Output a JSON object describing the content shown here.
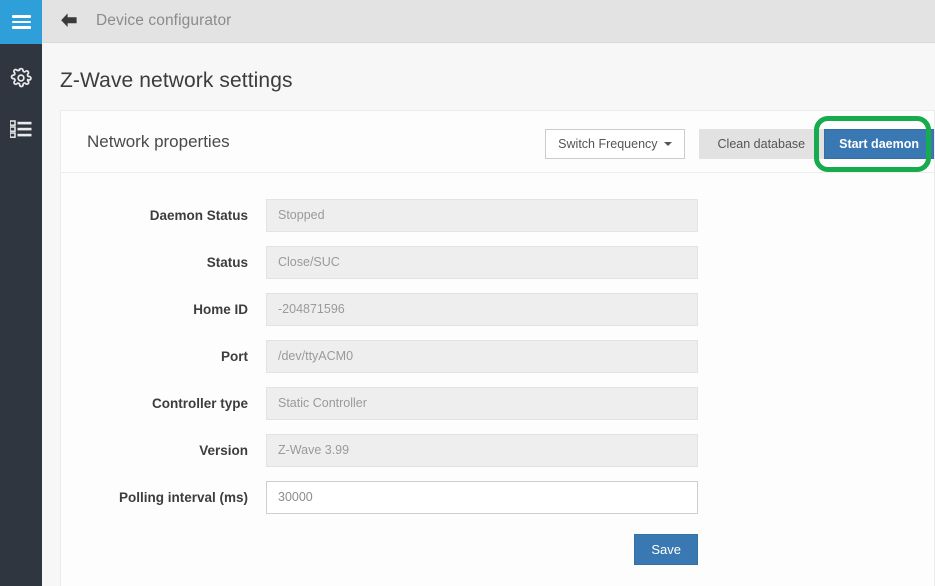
{
  "sidebar": {
    "items": [
      {
        "name": "menu-toggle",
        "icon": "hamburger-icon",
        "active": true
      },
      {
        "name": "settings",
        "icon": "gear-icon",
        "active": false
      },
      {
        "name": "list",
        "icon": "list-icon",
        "active": false
      }
    ]
  },
  "topbar": {
    "back_icon": "back-arrow-icon",
    "title": "Device configurator"
  },
  "page": {
    "title": "Z-Wave network settings"
  },
  "card": {
    "title": "Network properties",
    "actions": {
      "switch_frequency_label": "Switch Frequency",
      "clean_database_label": "Clean database",
      "start_daemon_label": "Start daemon"
    }
  },
  "form": {
    "rows": [
      {
        "label": "Daemon Status",
        "value": "Stopped",
        "editable": false
      },
      {
        "label": "Status",
        "value": "Close/SUC",
        "editable": false
      },
      {
        "label": "Home ID",
        "value": "-204871596",
        "editable": false
      },
      {
        "label": "Port",
        "value": "/dev/ttyACM0",
        "editable": false
      },
      {
        "label": "Controller type",
        "value": "Static Controller",
        "editable": false
      },
      {
        "label": "Version",
        "value": "Z-Wave 3.99",
        "editable": false
      },
      {
        "label": "Polling interval (ms)",
        "value": "30000",
        "editable": true
      }
    ],
    "save_label": "Save"
  },
  "annotation": {
    "name": "green-highlight-ring",
    "target": "start-daemon-button",
    "color": "#18ab4d"
  },
  "colors": {
    "accent_blue": "#2e9fd8",
    "sidebar_dark": "#2f3640",
    "primary_button": "#3a78b4",
    "topbar_gray": "#e3e3e3",
    "page_bg": "#f7f7f7",
    "highlight_green": "#18ab4d"
  }
}
